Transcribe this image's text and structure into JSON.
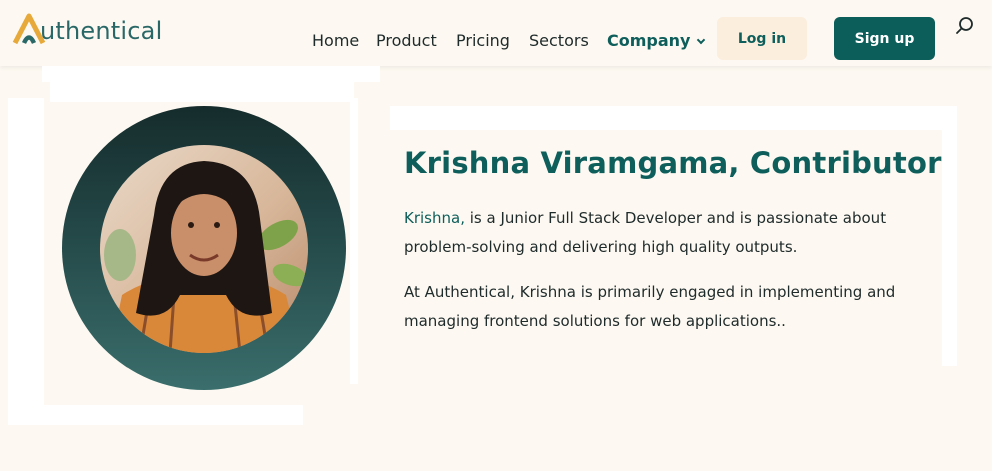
{
  "brand": {
    "name": "uthentical",
    "mark_letter": "A",
    "colors": {
      "teal": "#0c5e5b",
      "gold": "#e6a93a",
      "cream": "#fdf9f2"
    }
  },
  "nav": {
    "items": [
      {
        "label": "Home"
      },
      {
        "label": "Product"
      },
      {
        "label": "Pricing"
      },
      {
        "label": "Sectors"
      },
      {
        "label": "Company",
        "active": true,
        "has_dropdown": true
      }
    ],
    "login_label": "Log in",
    "signup_label": "Sign up",
    "search_icon": "search-icon"
  },
  "profile": {
    "title": "Krishna Viramgama, Contributor",
    "bio_name": "Krishna,",
    "bio_rest": " is a Junior Full Stack Developer and is passionate about problem-solving and delivering high quality outputs.",
    "bio_second": "At Authentical, Krishna is primarily engaged in implementing and managing frontend solutions for web applications.."
  }
}
